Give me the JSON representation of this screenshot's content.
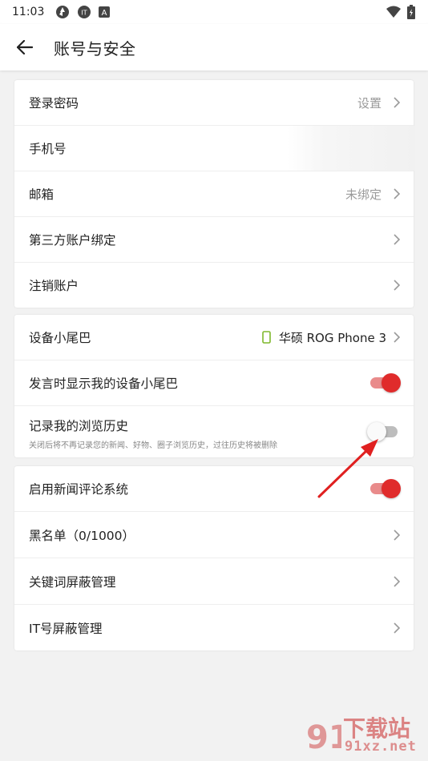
{
  "status_bar": {
    "time": "11:03",
    "icons": [
      "camera-aperture-icon",
      "ithome-icon",
      "a-icon"
    ],
    "right_icons": [
      "wifi-icon",
      "battery-icon"
    ]
  },
  "header": {
    "back_icon": "back-arrow-icon",
    "title": "账号与安全"
  },
  "account_section": {
    "items": [
      {
        "label": "登录密码",
        "value": "设置"
      },
      {
        "label": "手机号",
        "value": ""
      },
      {
        "label": "邮箱",
        "value": "未绑定"
      },
      {
        "label": "第三方账户绑定",
        "value": ""
      },
      {
        "label": "注销账户",
        "value": ""
      }
    ]
  },
  "device_section": {
    "tail": {
      "label": "设备小尾巴",
      "value": "华硕 ROG Phone 3",
      "icon": "phone-icon"
    },
    "show_tail": {
      "label": "发言时显示我的设备小尾巴",
      "enabled": true
    },
    "history": {
      "label": "记录我的浏览历史",
      "description": "关闭后将不再记录您的新闻、好物、圈子浏览历史，过往历史将被删除",
      "enabled": false
    }
  },
  "comment_section": {
    "news_comments": {
      "label": "启用新闻评论系统",
      "enabled": true
    },
    "blacklist": {
      "label": "黑名单（0/1000）"
    },
    "keyword_block": {
      "label": "关键词屏蔽管理"
    },
    "it_block": {
      "label": "IT号屏蔽管理"
    }
  },
  "watermark": {
    "line1": "下载站",
    "line2": "91xz.net",
    "logo": "91"
  },
  "colors": {
    "accent": "#e02b2b",
    "accent_track": "#e98b8b",
    "background": "#f2f2f2",
    "device_icon": "#7fb82c"
  }
}
